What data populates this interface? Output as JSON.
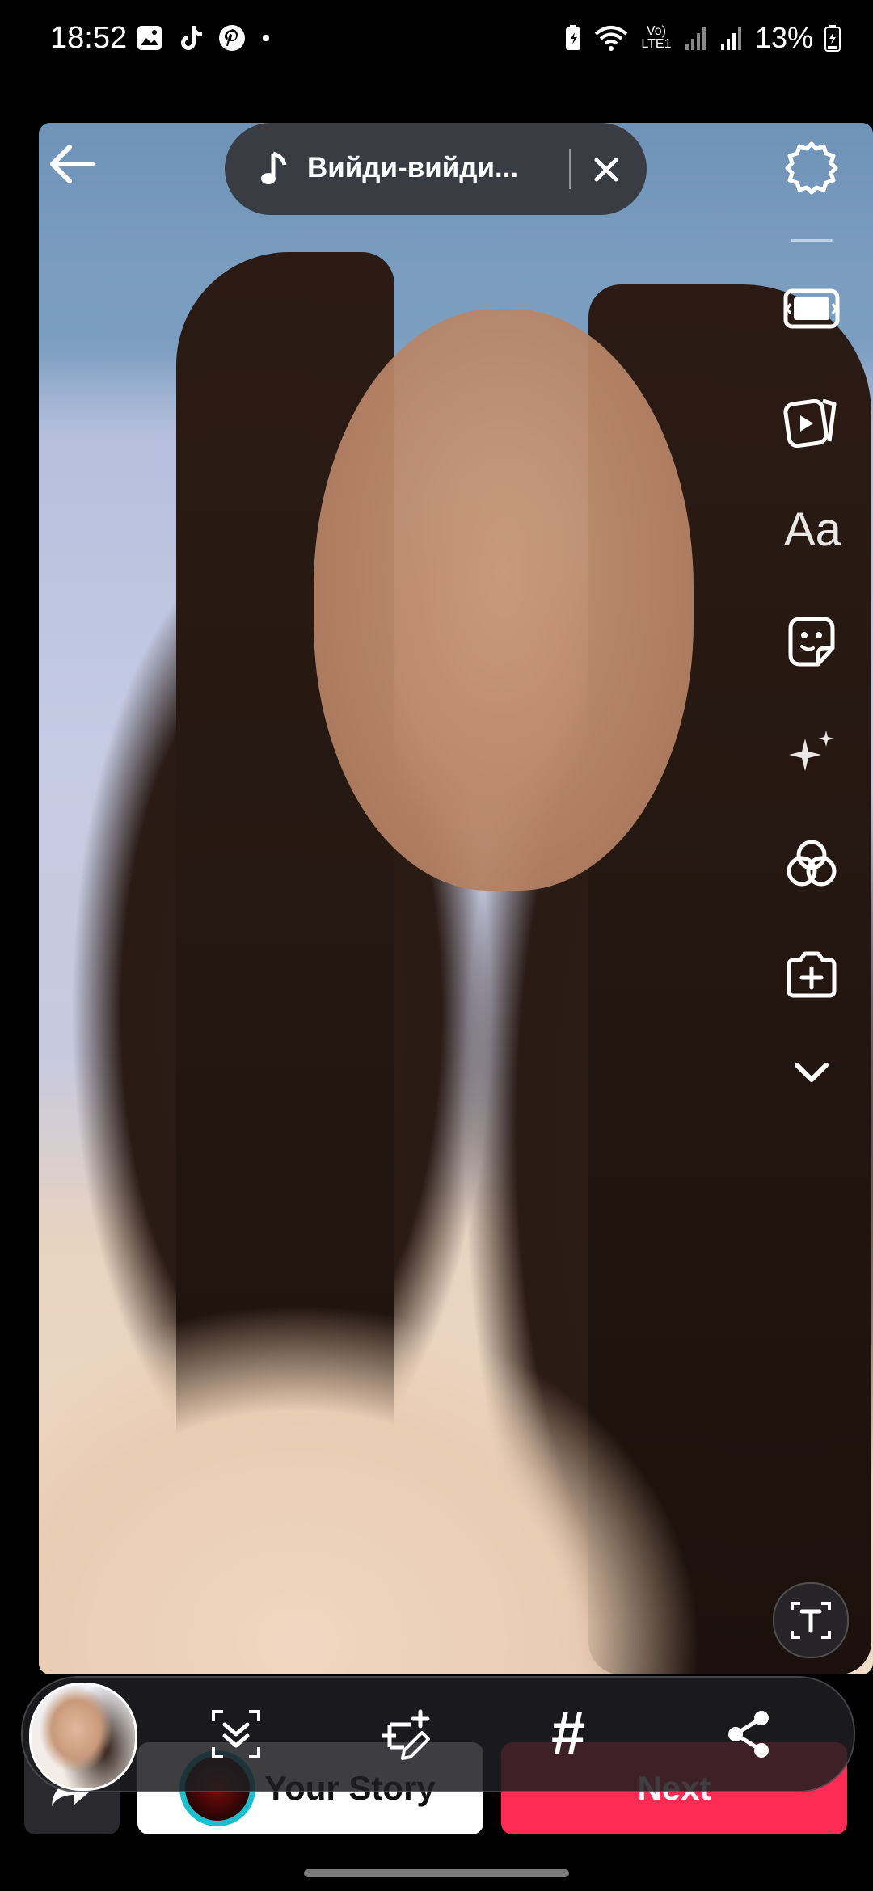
{
  "status_bar": {
    "time": "18:52",
    "battery": "13%",
    "network_label": "Vo) LTE1",
    "left_icons": [
      "gallery-icon",
      "tiktok-icon",
      "pinterest-icon",
      "dot-icon"
    ],
    "right_icons": [
      "battery-saver-icon",
      "wifi-icon",
      "signal-icon",
      "signal-icon",
      "battery-icon"
    ]
  },
  "music": {
    "title": "Вийди-вийди...",
    "icon": "music-note-icon"
  },
  "right_rail": {
    "items": [
      "settings-icon",
      "aspect-ratio-icon",
      "video-templates-icon",
      "text-icon",
      "sticker-icon",
      "effects-icon",
      "filters-icon",
      "add-clip-icon",
      "chevron-down-icon"
    ],
    "text_tool_label": "Aa"
  },
  "caption_tool": {
    "icon": "caption-text-icon"
  },
  "bottom_actions": {
    "your_story_label": "Your Story",
    "next_label": "Next"
  },
  "floating_toolbar": {
    "items": [
      "download-icon",
      "edit-cover-icon",
      "hashtag-icon",
      "share-icon"
    ],
    "hashtag_glyph": "#"
  },
  "colors": {
    "accent_red": "#fe2c55",
    "story_ring": "#19c0cf"
  }
}
